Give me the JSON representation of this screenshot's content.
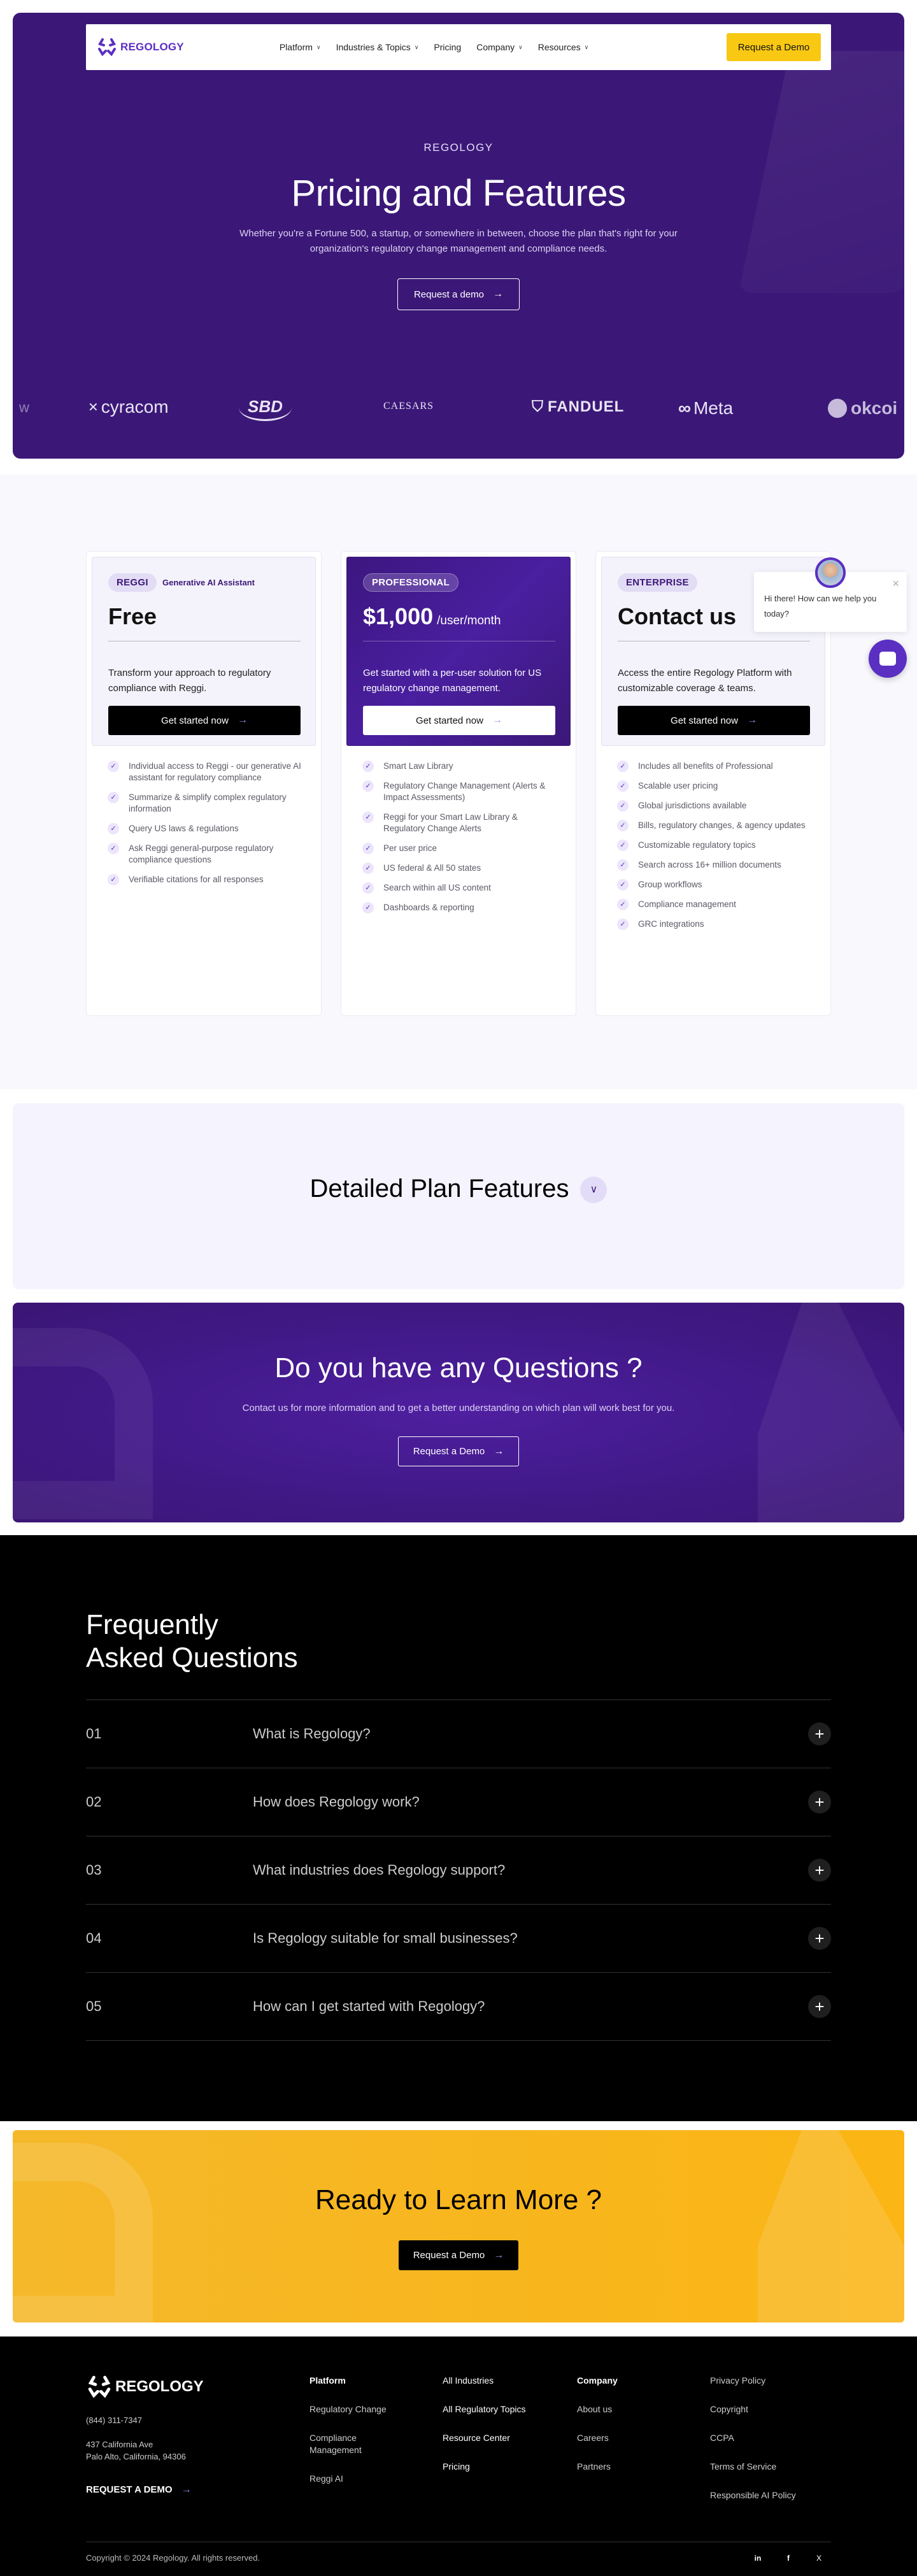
{
  "nav": {
    "brand": "REGOLOGY",
    "items": [
      {
        "label": "Platform",
        "has_dropdown": true
      },
      {
        "label": "Industries & Topics",
        "has_dropdown": true
      },
      {
        "label": "Pricing",
        "has_dropdown": false
      },
      {
        "label": "Company",
        "has_dropdown": true
      },
      {
        "label": "Resources",
        "has_dropdown": true
      }
    ],
    "cta": "Request a Demo"
  },
  "hero": {
    "eyebrow": "REGOLOGY",
    "title": "Pricing and Features",
    "subtitle": "Whether you're a Fortune 500, a startup, or somewhere in between, choose the plan that's right for your organization's regulatory change management and compliance needs.",
    "button": "Request a demo",
    "arrow": "→",
    "logos": [
      "w",
      "cyracom",
      "SBD",
      "CAESARS",
      "FANDUEL",
      "Meta",
      "okcoi"
    ]
  },
  "plans": [
    {
      "badge": "REGGI",
      "badge_note": "Generative AI Assistant",
      "price": "Free",
      "unit": "",
      "description": "Transform your approach to regulatory compliance with Reggi.",
      "cta": "Get started now",
      "features": [
        "Individual access to Reggi - our generative AI assistant for regulatory compliance",
        "Summarize & simplify complex regulatory information",
        "Query US laws & regulations",
        "Ask Reggi general-purpose regulatory compliance questions",
        "Verifiable citations for all responses"
      ]
    },
    {
      "badge": "PROFESSIONAL",
      "badge_note": "",
      "price": "$1,000",
      "unit": "/user/month",
      "description": "Get started with a per-user solution for US regulatory change management.",
      "cta": "Get started now",
      "features": [
        "Smart Law Library",
        "Regulatory Change Management (Alerts & Impact Assessments)",
        "Reggi for your Smart Law Library & Regulatory Change Alerts",
        "Per user price",
        "US federal & All 50 states",
        "Search within all US content",
        "Dashboards & reporting"
      ]
    },
    {
      "badge": "ENTERPRISE",
      "badge_note": "",
      "price": "Contact us",
      "unit": "",
      "description": "Access the entire Regology Platform with customizable coverage & teams.",
      "cta": "Get started now",
      "features": [
        "Includes all benefits of Professional",
        "Scalable user pricing",
        "Global jurisdictions available",
        "Bills, regulatory changes, & agency updates",
        "Customizable regulatory topics",
        "Search across 16+ million documents",
        "Group workflows",
        "Compliance management",
        "GRC integrations"
      ]
    }
  ],
  "chat": {
    "message": "Hi there! How can we help you today?",
    "close": "×"
  },
  "detailed": {
    "title": "Detailed Plan Features",
    "toggle": "∨"
  },
  "questions": {
    "title": "Do you have any Questions ?",
    "subtitle": "Contact us for more information and to get a better understanding on which plan will work best for you.",
    "button": "Request a Demo"
  },
  "faq": {
    "title_line1": "Frequently",
    "title_line2": "Asked Questions",
    "items": [
      {
        "num": "01",
        "question": "What is Regology?"
      },
      {
        "num": "02",
        "question": "How does Regology work?"
      },
      {
        "num": "03",
        "question": "What industries does Regology support?"
      },
      {
        "num": "04",
        "question": "Is Regology suitable for small businesses?"
      },
      {
        "num": "05",
        "question": "How can I get started with Regology?"
      }
    ],
    "expand_glyph": "+"
  },
  "ready": {
    "title": "Ready to Learn More ?",
    "button": "Request a Demo"
  },
  "footer": {
    "brand": "REGOLOGY",
    "phone": "(844) 311-7347",
    "address_line1": "437 California Ave",
    "address_line2": "Palo Alto, California, 94306",
    "demo": "REQUEST A DEMO",
    "col1": [
      "Platform",
      "Regulatory Change",
      "Compliance Management",
      "Reggi AI"
    ],
    "col2": [
      "All Industries",
      "All Regulatory Topics",
      "Resource Center",
      "Pricing"
    ],
    "col3": [
      "Company",
      "About us",
      "Careers",
      "Partners"
    ],
    "col4": [
      "Privacy Policy",
      "Copyright",
      "CCPA",
      "Terms of Service",
      "Responsible AI Policy"
    ],
    "copyright": "Copyright © 2024 Regology. All rights reserved.",
    "social": [
      "in",
      "f",
      "X"
    ]
  },
  "colors": {
    "brand_purple": "#3b1877",
    "accent_purple": "#5a2fc2",
    "cta_yellow": "#f8c813"
  }
}
